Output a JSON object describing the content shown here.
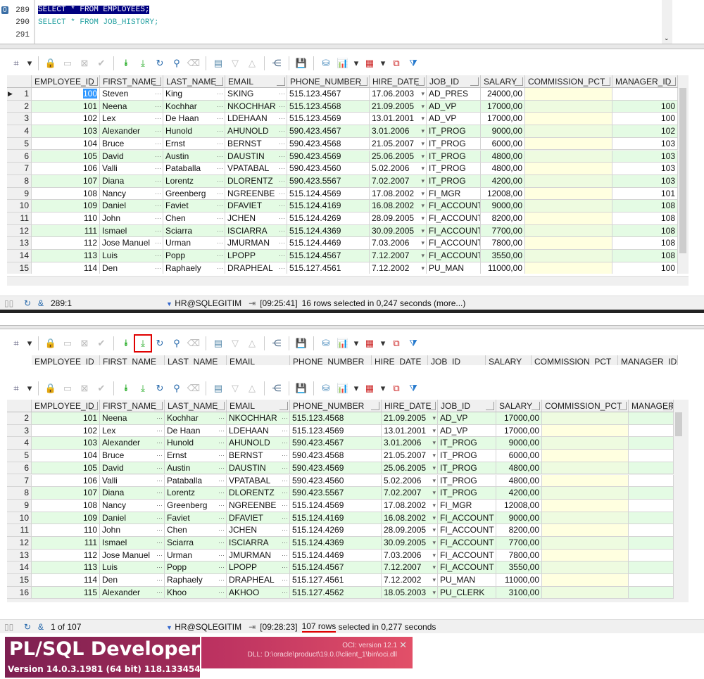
{
  "editor": {
    "lines": [
      {
        "num": "289",
        "text": "SELECT * FROM EMPLOYEES;",
        "selected": true,
        "marker": "0"
      },
      {
        "num": "290",
        "text": "SELECT * FROM JOB_HISTORY;"
      },
      {
        "num": "291",
        "text": ""
      }
    ]
  },
  "columns": [
    "EMPLOYEE_ID",
    "FIRST_NAME",
    "LAST_NAME",
    "EMAIL",
    "PHONE_NUMBER",
    "HIRE_DATE",
    "JOB_ID",
    "SALARY",
    "COMMISSION_PCT",
    "MANAGER_ID"
  ],
  "rows": [
    [
      "100",
      "Steven",
      "King",
      "SKING",
      "515.123.4567",
      "17.06.2003",
      "AD_PRES",
      "24000,00",
      "",
      ""
    ],
    [
      "101",
      "Neena",
      "Kochhar",
      "NKOCHHAR",
      "515.123.4568",
      "21.09.2005",
      "AD_VP",
      "17000,00",
      "",
      "100"
    ],
    [
      "102",
      "Lex",
      "De Haan",
      "LDEHAAN",
      "515.123.4569",
      "13.01.2001",
      "AD_VP",
      "17000,00",
      "",
      "100"
    ],
    [
      "103",
      "Alexander",
      "Hunold",
      "AHUNOLD",
      "590.423.4567",
      "3.01.2006",
      "IT_PROG",
      "9000,00",
      "",
      "102"
    ],
    [
      "104",
      "Bruce",
      "Ernst",
      "BERNST",
      "590.423.4568",
      "21.05.2007",
      "IT_PROG",
      "6000,00",
      "",
      "103"
    ],
    [
      "105",
      "David",
      "Austin",
      "DAUSTIN",
      "590.423.4569",
      "25.06.2005",
      "IT_PROG",
      "4800,00",
      "",
      "103"
    ],
    [
      "106",
      "Valli",
      "Pataballa",
      "VPATABAL",
      "590.423.4560",
      "5.02.2006",
      "IT_PROG",
      "4800,00",
      "",
      "103"
    ],
    [
      "107",
      "Diana",
      "Lorentz",
      "DLORENTZ",
      "590.423.5567",
      "7.02.2007",
      "IT_PROG",
      "4200,00",
      "",
      "103"
    ],
    [
      "108",
      "Nancy",
      "Greenberg",
      "NGREENBE",
      "515.124.4569",
      "17.08.2002",
      "FI_MGR",
      "12008,00",
      "",
      "101"
    ],
    [
      "109",
      "Daniel",
      "Faviet",
      "DFAVIET",
      "515.124.4169",
      "16.08.2002",
      "FI_ACCOUNT",
      "9000,00",
      "",
      "108"
    ],
    [
      "110",
      "John",
      "Chen",
      "JCHEN",
      "515.124.4269",
      "28.09.2005",
      "FI_ACCOUNT",
      "8200,00",
      "",
      "108"
    ],
    [
      "111",
      "Ismael",
      "Sciarra",
      "ISCIARRA",
      "515.124.4369",
      "30.09.2005",
      "FI_ACCOUNT",
      "7700,00",
      "",
      "108"
    ],
    [
      "112",
      "Jose Manuel",
      "Urman",
      "JMURMAN",
      "515.124.4469",
      "7.03.2006",
      "FI_ACCOUNT",
      "7800,00",
      "",
      "108"
    ],
    [
      "113",
      "Luis",
      "Popp",
      "LPOPP",
      "515.124.4567",
      "7.12.2007",
      "FI_ACCOUNT",
      "3550,00",
      "",
      "108"
    ],
    [
      "114",
      "Den",
      "Raphaely",
      "DRAPHEAL",
      "515.127.4561",
      "7.12.2002",
      "PU_MAN",
      "11000,00",
      "",
      "100"
    ],
    [
      "115",
      "Alexander",
      "Khoo",
      "AKHOO",
      "515.127.4562",
      "18.05.2003",
      "PU_CLERK",
      "3100,00",
      "",
      ""
    ]
  ],
  "status_top": {
    "position": "289:1",
    "connection": "HR@SQLEGITIM",
    "time": "[09:25:41]",
    "message": "16 rows selected in 0,247 seconds (more...)"
  },
  "status_bottom": {
    "position": "1 of 107",
    "connection": "HR@SQLEGITIM",
    "time": "[09:28:23]",
    "rows_text": "107 rows",
    "message": " selected in 0,277 seconds"
  },
  "splash": {
    "title": "PL/SQL Developer",
    "version": "Version 14.0.3.1981  (64 bit) 118.133454",
    "oci": "OCI: version 12.1",
    "dll": "DLL: D:\\oracle\\product\\19.0.0\\client_1\\bin\\oci.dll",
    "close": "✕"
  },
  "colors": {
    "row_alt": "#e4fbe4",
    "commission": "#ffffe0",
    "highlight": "#e00000",
    "selection": "#000080"
  }
}
